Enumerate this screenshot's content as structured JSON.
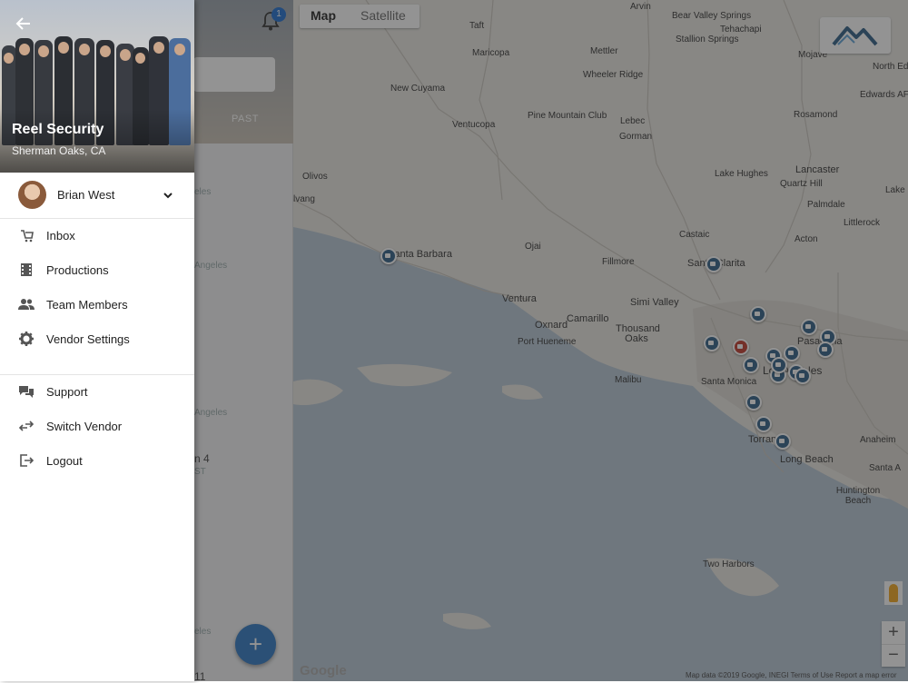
{
  "drawer": {
    "company_name": "Reel Security",
    "company_location": "Sherman Oaks, CA",
    "user_name": "Brian West",
    "menu": [
      {
        "label": "Inbox",
        "icon": "inbox-icon"
      },
      {
        "label": "Productions",
        "icon": "film-icon"
      },
      {
        "label": "Team Members",
        "icon": "people-icon"
      },
      {
        "label": "Vendor Settings",
        "icon": "gear-icon"
      }
    ],
    "menu2": [
      {
        "label": "Support",
        "icon": "chat-icon"
      },
      {
        "label": "Switch Vendor",
        "icon": "swap-icon"
      },
      {
        "label": "Logout",
        "icon": "logout-icon"
      }
    ]
  },
  "list_panel": {
    "tab_past": "PAST",
    "notification_count": "1",
    "ghost_texts": [
      "eles",
      "Angeles",
      "Angeles",
      "n 4",
      "ST",
      "eles",
      "11"
    ]
  },
  "map": {
    "tab_map": "Map",
    "tab_satellite": "Satellite",
    "google_logo": "Google",
    "footer": "Map data ©2019 Google, INEGI   Terms of Use   Report a map error",
    "zoom_in": "+",
    "zoom_out": "−",
    "places": [
      "Arvin",
      "Bear Valley Springs",
      "Tehachapi",
      "Stallion Springs",
      "Taft",
      "Maricopa",
      "Mettler",
      "Wheeler Ridge",
      "Mojave",
      "North Edw",
      "New Cuyama",
      "Edwards AFB",
      "Ventucopa",
      "Pine Mountain Club",
      "Lebec",
      "Gorman",
      "Rosamond",
      "Lancaster",
      "Quartz Hill",
      "Lake Hughes",
      "Lake Lo",
      "Palmdale",
      "Littlerock",
      "Castaic",
      "Acton",
      "Olivos",
      "lvang",
      "Santa Barbara",
      "Ojai",
      "Fillmore",
      "Santa Clarita",
      "Ventura",
      "Simi Valley",
      "Oxnard",
      "Camarillo",
      "Thousand Oaks",
      "Port Hueneme",
      "Pasadena",
      "Los Angeles",
      "Santa Monica",
      "Malibu",
      "Torrance",
      "Long Beach",
      "Anaheim",
      "Santa A",
      "Huntington Beach",
      "Two Harbors"
    ]
  },
  "fab_label": "+",
  "colors": {
    "marker": "#2f5f86",
    "marker_active": "#c0392b",
    "accent": "#1f6fd1"
  }
}
